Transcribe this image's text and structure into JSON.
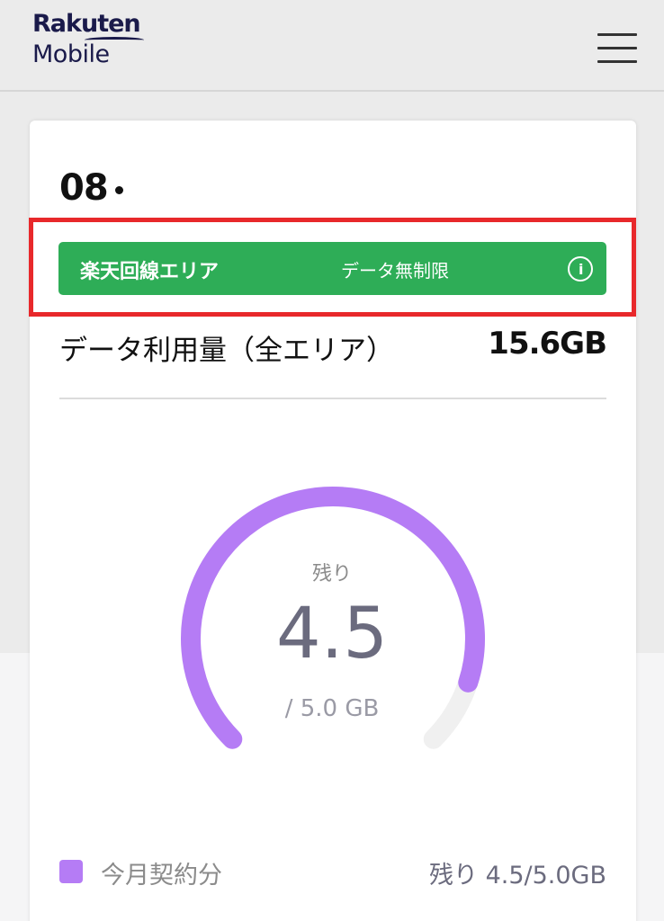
{
  "header": {
    "logo_line1": "Rakuten",
    "logo_line2": "Mobile",
    "menu_icon": "hamburger-menu-icon"
  },
  "line": {
    "phone_number_prefix": "08"
  },
  "area_banner": {
    "area_name": "楽天回線エリア",
    "plan": "データ無制限",
    "info_icon": "info-icon",
    "color": "#2ead57",
    "highlight_color": "#e8282b"
  },
  "usage": {
    "label": "データ利用量（全エリア）",
    "value": "15.6GB"
  },
  "gauge": {
    "label": "残り",
    "remaining": "4.5",
    "total": "/ 5.0 GB",
    "remaining_fraction": 0.9,
    "color": "#b57cf5",
    "track_color": "#f0f0f0"
  },
  "legend": {
    "label": "今月契約分",
    "value": "残り 4.5/5.0GB",
    "color": "#b57cf5"
  }
}
